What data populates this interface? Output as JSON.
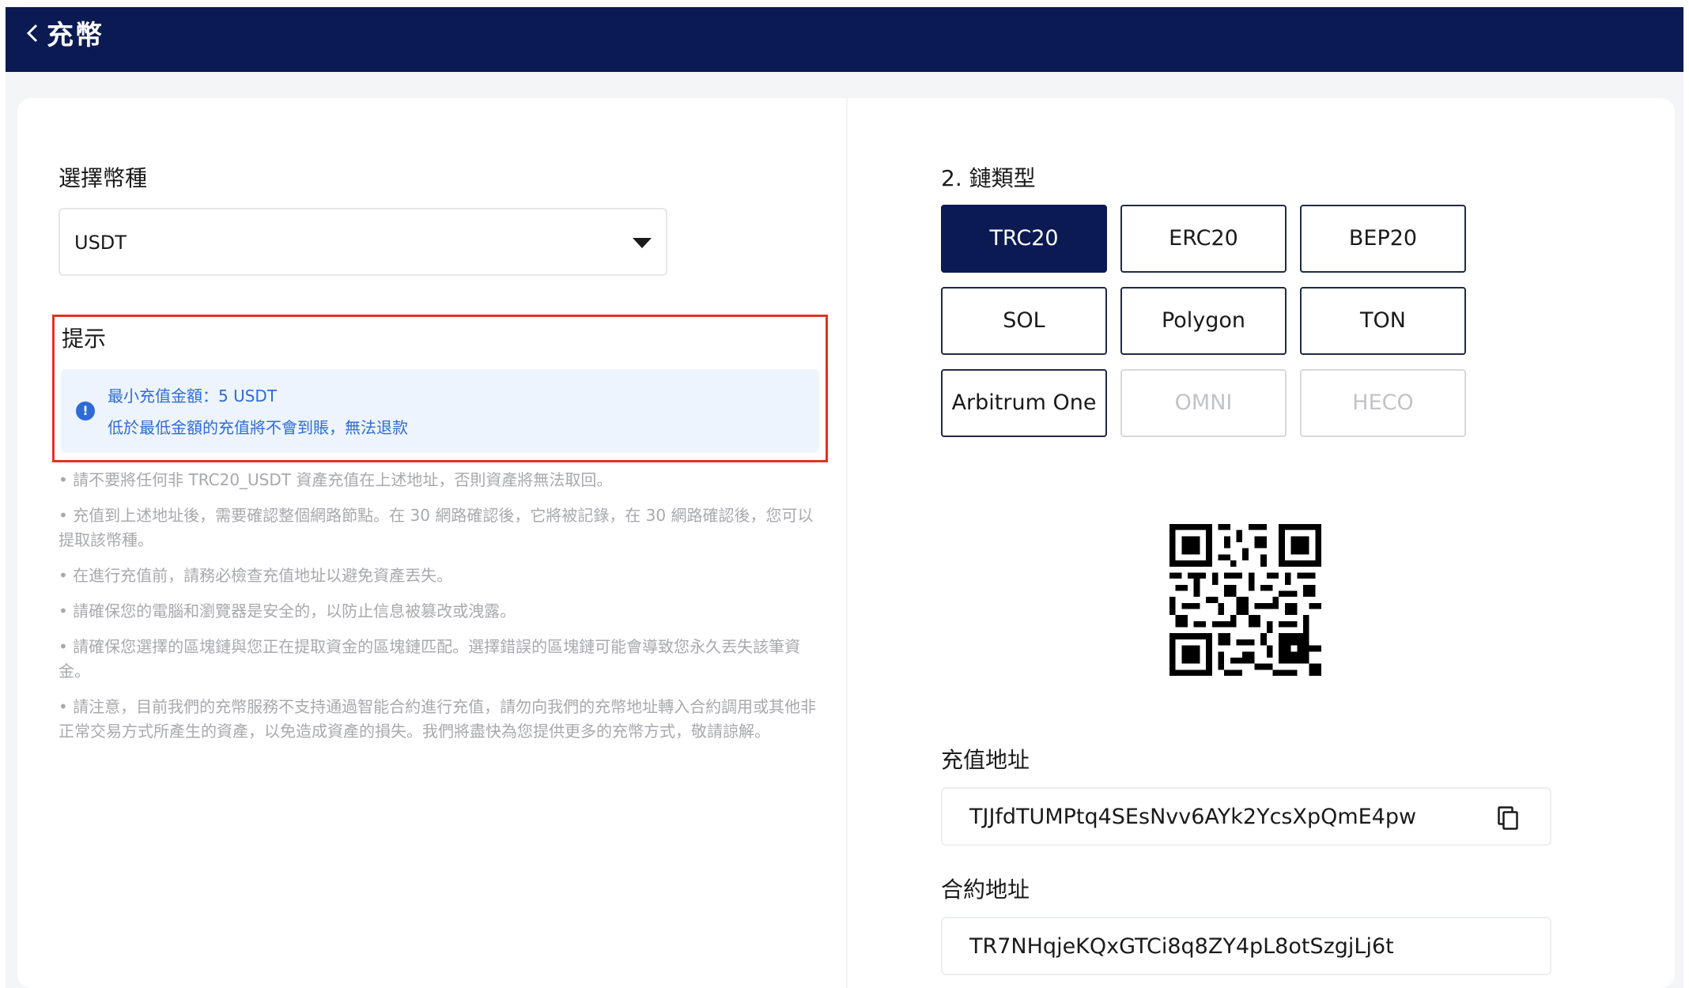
{
  "header": {
    "title": "充幣",
    "back_icon": "chevron-left-icon"
  },
  "coin_select": {
    "label": "選擇幣種",
    "value": "USDT",
    "icon": "caret-down-icon"
  },
  "tip": {
    "title": "提示",
    "notice_icon": "info-icon",
    "notice_line_1": "最小充值金額：5 USDT",
    "notice_line_2": "低於最低金額的充值將不會到賬，無法退款"
  },
  "notes": [
    "• 請不要將任何非 TRC20_USDT 資產充值在上述地址，否則資產將無法取回。",
    "• 充值到上述地址後，需要確認整個網路節點。在 30 網路確認後，它將被記錄，在 30 網路確認後，您可以提取該幣種。",
    "• 在進行充值前，請務必檢查充值地址以避免資產丟失。",
    "• 請確保您的電腦和瀏覽器是安全的，以防止信息被篡改或洩露。",
    "• 請確保您選擇的區塊鏈與您正在提取資金的區塊鏈匹配。選擇錯誤的區塊鏈可能會導致您永久丟失該筆資金。",
    "• 請注意，目前我們的充幣服務不支持通過智能合約進行充值，請勿向我們的充幣地址轉入合約調用或其他非正常交易方式所產生的資產，以免造成資產的損失。我們將盡快為您提供更多的充幣方式，敬請諒解。"
  ],
  "chain": {
    "label": "2. 鏈類型",
    "options": [
      {
        "label": "TRC20",
        "state": "active"
      },
      {
        "label": "ERC20",
        "state": "enabled"
      },
      {
        "label": "BEP20",
        "state": "enabled"
      },
      {
        "label": "SOL",
        "state": "enabled"
      },
      {
        "label": "Polygon",
        "state": "enabled"
      },
      {
        "label": "TON",
        "state": "enabled"
      },
      {
        "label": "Arbitrum One",
        "state": "enabled"
      },
      {
        "label": "OMNI",
        "state": "disabled"
      },
      {
        "label": "HECO",
        "state": "disabled"
      }
    ]
  },
  "qr_icon": "qr-code",
  "deposit_address": {
    "label": "充值地址",
    "value": "TJJfdTUMPtq4SEsNvv6AYk2YcsXpQmE4pw",
    "copy_icon": "copy-icon"
  },
  "contract_address": {
    "label": "合約地址",
    "value": "TR7NHqjeKQxGTCi8q8ZY4pL8otSzgjLj6t"
  },
  "colors": {
    "header_bg": "#0b1a52",
    "active_chain_bg": "#0b1a52",
    "notice_text": "#2e6bd9",
    "notice_bg": "#eef4fd",
    "highlight_border": "#e2321f"
  }
}
